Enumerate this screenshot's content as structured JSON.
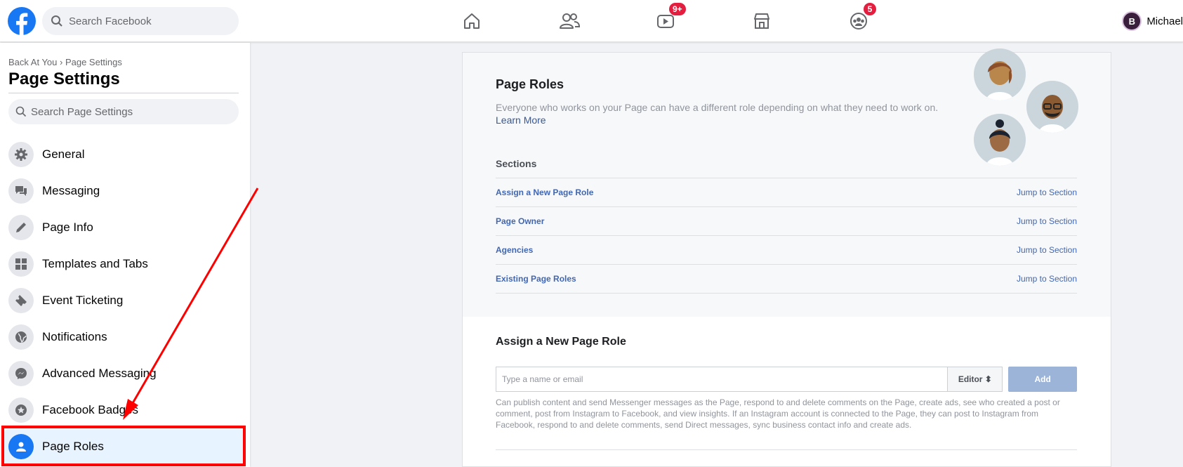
{
  "topbar": {
    "search_placeholder": "Search Facebook",
    "watch_badge": "9+",
    "groups_badge": "5",
    "profile_initial": "B",
    "profile_name": "Michael",
    "icons": [
      "facebook-logo",
      "home-icon",
      "friends-icon",
      "watch-icon",
      "marketplace-icon",
      "groups-icon"
    ]
  },
  "sidebar": {
    "breadcrumb": "Back At You › Page Settings",
    "title": "Page Settings",
    "search_placeholder": "Search Page Settings",
    "items": [
      {
        "label": "General",
        "icon": "gear-icon"
      },
      {
        "label": "Messaging",
        "icon": "chat-icon"
      },
      {
        "label": "Page Info",
        "icon": "pencil-icon"
      },
      {
        "label": "Templates and Tabs",
        "icon": "grid-icon"
      },
      {
        "label": "Event Ticketing",
        "icon": "ticket-icon"
      },
      {
        "label": "Notifications",
        "icon": "globe-icon"
      },
      {
        "label": "Advanced Messaging",
        "icon": "messenger-icon"
      },
      {
        "label": "Facebook Badges",
        "icon": "badge-icon"
      },
      {
        "label": "Page Roles",
        "icon": "person-icon",
        "active": true
      }
    ]
  },
  "main": {
    "title": "Page Roles",
    "description": "Everyone who works on your Page can have a different role depending on what they need to work on.",
    "learn_more": "Learn More",
    "sections_label": "Sections",
    "sections": [
      {
        "name": "Assign a New Page Role",
        "jump": "Jump to Section"
      },
      {
        "name": "Page Owner",
        "jump": "Jump to Section"
      },
      {
        "name": "Agencies",
        "jump": "Jump to Section"
      },
      {
        "name": "Existing Page Roles",
        "jump": "Jump to Section"
      }
    ],
    "assign": {
      "title": "Assign a New Page Role",
      "input_placeholder": "Type a name or email",
      "role_selected": "Editor ⬍",
      "add_label": "Add",
      "help_text": "Can publish content and send Messenger messages as the Page, respond to and delete comments on the Page, create ads, see who created a post or comment, post from Instagram to Facebook, and view insights. If an Instagram account is connected to the Page, they can post to Instagram from Facebook, respond to and delete comments, send Direct messages, sync business contact info and create ads."
    }
  },
  "colors": {
    "brand": "#1877f2",
    "link": "#4267b2",
    "annotation": "#ff0000",
    "add_disabled": "#9cb4d8"
  }
}
